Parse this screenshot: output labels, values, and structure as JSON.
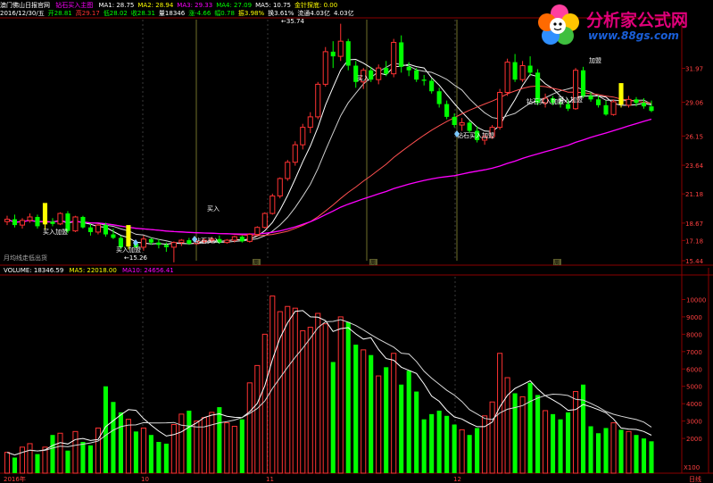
{
  "header": {
    "title": "澳门佛山日报官网",
    "indicator_name": "钻石买入主图",
    "row1_values": [
      {
        "text": "MA1: 28.75",
        "color": "#ffffff"
      },
      {
        "text": "MA2: 28.94",
        "color": "#ffff00"
      },
      {
        "text": "MA3: 29.33",
        "color": "#ff00ff"
      },
      {
        "text": "MA4: 27.09",
        "color": "#00ff00"
      },
      {
        "text": "MA5: 10.75",
        "color": "#ffffff"
      },
      {
        "text": "金针探底: 0.00",
        "color": "#ffff00"
      }
    ],
    "row2_values": [
      {
        "text": "2016/12/30/五",
        "color": "#ffffff"
      },
      {
        "text": "开28.81",
        "color": "#00ff00"
      },
      {
        "text": "高29.17",
        "color": "#ff3030"
      },
      {
        "text": "低28.02",
        "color": "#00ff00"
      },
      {
        "text": "收28.31",
        "color": "#00ff00"
      },
      {
        "text": "量18346",
        "color": "#ffffff"
      },
      {
        "text": "涨-4.66",
        "color": "#00ff00"
      },
      {
        "text": "幅0.78",
        "color": "#00ff00"
      },
      {
        "text": "振3.98%",
        "color": "#ffff00"
      },
      {
        "text": "换3.61%",
        "color": "#ffffff"
      },
      {
        "text": "流通4.03亿",
        "color": "#ffffff"
      },
      {
        "text": "4.03亿",
        "color": "#ffffff"
      }
    ]
  },
  "watermark": {
    "title": "分析家公式网",
    "url": "www.88gs.com"
  },
  "price_panel": {
    "y_axis": [
      "31.97",
      "29.06",
      "26.15",
      "23.64",
      "21.18",
      "18.67",
      "17.18",
      "15.44"
    ],
    "peak_label": "←35.74",
    "low_label": "←15.26",
    "annotations": [
      {
        "text": "买入加盟"
      },
      {
        "text": "买入加盟"
      },
      {
        "text": "钻石买入"
      },
      {
        "text": "钻石买入加盟"
      },
      {
        "text": "钻石买入加盟"
      },
      {
        "text": "买入加盟"
      },
      {
        "text": "买入"
      },
      {
        "text": "买入"
      },
      {
        "text": "加盟"
      }
    ],
    "bottom_left_label": "月均线走低出货",
    "markers": [
      "周",
      "周",
      "周"
    ]
  },
  "volume_panel": {
    "label": "VOLUME: 18346.59",
    "ma5": "MA5: 22018.00",
    "ma10": "MA10: 24656.41",
    "y_axis": [
      "10000",
      "9000",
      "8000",
      "7000",
      "6000",
      "5000",
      "4000",
      "3000",
      "2000"
    ],
    "unit": "X100"
  },
  "x_axis": {
    "labels": [
      "2016年",
      "10",
      "11",
      "12"
    ],
    "right_label": "日线"
  },
  "colors": {
    "up": "#ff3232",
    "down": "#00ff00",
    "background": "#000000",
    "ma_short": "#ffffff",
    "ma_mid": "#ff5050",
    "ma_long": "#ff00ff",
    "highlight": "#ffff00"
  },
  "chart_data": {
    "type": "candlestick",
    "y_range": [
      15.44,
      36.0
    ],
    "volume_range": [
      0,
      11000
    ],
    "candles": [
      {
        "o": 18.8,
        "h": 19.3,
        "l": 18.5,
        "c": 19.0,
        "v": 1200
      },
      {
        "o": 19.0,
        "h": 19.4,
        "l": 18.3,
        "c": 18.5,
        "v": 900
      },
      {
        "o": 18.5,
        "h": 19.1,
        "l": 18.2,
        "c": 18.9,
        "v": 1500
      },
      {
        "o": 18.9,
        "h": 19.5,
        "l": 18.7,
        "c": 19.2,
        "v": 1700
      },
      {
        "o": 19.2,
        "h": 19.4,
        "l": 18.2,
        "c": 18.4,
        "v": 1100
      },
      {
        "o": 18.4,
        "h": 19.0,
        "l": 18.1,
        "c": 18.8,
        "v": 1500
      },
      {
        "o": 18.8,
        "h": 19.1,
        "l": 18.4,
        "c": 18.6,
        "v": 2200
      },
      {
        "o": 18.6,
        "h": 19.6,
        "l": 18.5,
        "c": 19.5,
        "v": 2300
      },
      {
        "o": 19.5,
        "h": 19.7,
        "l": 17.8,
        "c": 18.0,
        "v": 1300
      },
      {
        "o": 18.0,
        "h": 19.3,
        "l": 17.9,
        "c": 19.2,
        "v": 2400
      },
      {
        "o": 19.2,
        "h": 19.3,
        "l": 18.2,
        "c": 18.3,
        "v": 1800
      },
      {
        "o": 18.3,
        "h": 18.6,
        "l": 17.6,
        "c": 17.9,
        "v": 1600
      },
      {
        "o": 17.9,
        "h": 18.6,
        "l": 17.7,
        "c": 18.5,
        "v": 2600
      },
      {
        "o": 18.5,
        "h": 18.7,
        "l": 17.5,
        "c": 17.7,
        "v": 5000
      },
      {
        "o": 17.7,
        "h": 18.2,
        "l": 17.3,
        "c": 17.4,
        "v": 4100
      },
      {
        "o": 17.4,
        "h": 17.6,
        "l": 16.4,
        "c": 16.6,
        "v": 3500
      },
      {
        "o": 16.6,
        "h": 17.2,
        "l": 16.4,
        "c": 16.9,
        "v": 3100
      },
      {
        "o": 16.9,
        "h": 17.0,
        "l": 16.5,
        "c": 16.6,
        "v": 2400
      },
      {
        "o": 16.6,
        "h": 17.6,
        "l": 16.3,
        "c": 17.3,
        "v": 2600
      },
      {
        "o": 17.3,
        "h": 17.4,
        "l": 16.8,
        "c": 17.0,
        "v": 2200
      },
      {
        "o": 17.0,
        "h": 17.3,
        "l": 16.5,
        "c": 16.8,
        "v": 1800
      },
      {
        "o": 16.8,
        "h": 17.0,
        "l": 16.2,
        "c": 16.6,
        "v": 1700
      },
      {
        "o": 16.6,
        "h": 17.1,
        "l": 15.3,
        "c": 17.0,
        "v": 2800
      },
      {
        "o": 17.0,
        "h": 17.3,
        "l": 16.7,
        "c": 17.2,
        "v": 3400
      },
      {
        "o": 17.2,
        "h": 17.4,
        "l": 16.8,
        "c": 16.9,
        "v": 3600
      },
      {
        "o": 16.9,
        "h": 17.3,
        "l": 16.8,
        "c": 17.1,
        "v": 3000
      },
      {
        "o": 17.1,
        "h": 17.4,
        "l": 16.9,
        "c": 17.2,
        "v": 3200
      },
      {
        "o": 17.2,
        "h": 17.5,
        "l": 17.0,
        "c": 17.3,
        "v": 3500
      },
      {
        "o": 17.3,
        "h": 17.6,
        "l": 16.9,
        "c": 17.0,
        "v": 3800
      },
      {
        "o": 17.0,
        "h": 17.3,
        "l": 16.9,
        "c": 17.2,
        "v": 2900
      },
      {
        "o": 17.2,
        "h": 17.6,
        "l": 17.0,
        "c": 17.5,
        "v": 2700
      },
      {
        "o": 17.5,
        "h": 17.6,
        "l": 17.0,
        "c": 17.1,
        "v": 3100
      },
      {
        "o": 17.1,
        "h": 17.8,
        "l": 17.0,
        "c": 17.7,
        "v": 5200
      },
      {
        "o": 17.7,
        "h": 18.4,
        "l": 17.6,
        "c": 18.3,
        "v": 6200
      },
      {
        "o": 18.3,
        "h": 19.6,
        "l": 18.2,
        "c": 19.5,
        "v": 8000
      },
      {
        "o": 19.5,
        "h": 21.2,
        "l": 19.4,
        "c": 21.0,
        "v": 10200
      },
      {
        "o": 21.0,
        "h": 22.6,
        "l": 20.8,
        "c": 22.5,
        "v": 9300
      },
      {
        "o": 22.5,
        "h": 24.1,
        "l": 22.3,
        "c": 23.9,
        "v": 9600
      },
      {
        "o": 23.9,
        "h": 25.7,
        "l": 23.6,
        "c": 25.4,
        "v": 9500
      },
      {
        "o": 25.4,
        "h": 27.2,
        "l": 25.0,
        "c": 26.9,
        "v": 8200
      },
      {
        "o": 26.9,
        "h": 28.2,
        "l": 26.4,
        "c": 27.8,
        "v": 8400
      },
      {
        "o": 27.8,
        "h": 30.8,
        "l": 27.6,
        "c": 30.6,
        "v": 9200
      },
      {
        "o": 30.6,
        "h": 33.8,
        "l": 30.4,
        "c": 33.4,
        "v": 8600
      },
      {
        "o": 33.4,
        "h": 34.3,
        "l": 32.0,
        "c": 33.0,
        "v": 6400
      },
      {
        "o": 33.0,
        "h": 35.8,
        "l": 32.6,
        "c": 34.3,
        "v": 9000
      },
      {
        "o": 34.3,
        "h": 34.5,
        "l": 31.8,
        "c": 32.2,
        "v": 8700
      },
      {
        "o": 32.2,
        "h": 32.6,
        "l": 30.3,
        "c": 30.8,
        "v": 7400
      },
      {
        "o": 30.8,
        "h": 32.0,
        "l": 30.2,
        "c": 31.8,
        "v": 7100
      },
      {
        "o": 31.8,
        "h": 32.1,
        "l": 30.8,
        "c": 31.0,
        "v": 6800
      },
      {
        "o": 31.0,
        "h": 32.3,
        "l": 30.6,
        "c": 32.0,
        "v": 5600
      },
      {
        "o": 32.0,
        "h": 32.6,
        "l": 31.3,
        "c": 31.5,
        "v": 6100
      },
      {
        "o": 31.5,
        "h": 34.5,
        "l": 31.2,
        "c": 34.2,
        "v": 6900
      },
      {
        "o": 34.2,
        "h": 34.8,
        "l": 31.6,
        "c": 32.1,
        "v": 5100
      },
      {
        "o": 32.1,
        "h": 32.5,
        "l": 31.3,
        "c": 31.8,
        "v": 5900
      },
      {
        "o": 31.8,
        "h": 32.0,
        "l": 30.8,
        "c": 31.0,
        "v": 4700
      },
      {
        "o": 31.0,
        "h": 31.4,
        "l": 30.5,
        "c": 30.9,
        "v": 3100
      },
      {
        "o": 30.9,
        "h": 31.1,
        "l": 29.8,
        "c": 30.0,
        "v": 3400
      },
      {
        "o": 30.0,
        "h": 30.3,
        "l": 28.6,
        "c": 28.9,
        "v": 3600
      },
      {
        "o": 28.9,
        "h": 29.2,
        "l": 27.6,
        "c": 27.8,
        "v": 3300
      },
      {
        "o": 27.8,
        "h": 28.1,
        "l": 26.9,
        "c": 27.1,
        "v": 2800
      },
      {
        "o": 27.1,
        "h": 27.7,
        "l": 26.6,
        "c": 27.3,
        "v": 2500
      },
      {
        "o": 27.3,
        "h": 27.5,
        "l": 26.4,
        "c": 26.6,
        "v": 2200
      },
      {
        "o": 26.6,
        "h": 27.0,
        "l": 25.6,
        "c": 25.8,
        "v": 2600
      },
      {
        "o": 25.8,
        "h": 26.4,
        "l": 25.4,
        "c": 26.1,
        "v": 3300
      },
      {
        "o": 26.1,
        "h": 27.1,
        "l": 25.9,
        "c": 26.9,
        "v": 4100
      },
      {
        "o": 26.9,
        "h": 30.2,
        "l": 26.7,
        "c": 29.9,
        "v": 6900
      },
      {
        "o": 29.9,
        "h": 32.8,
        "l": 29.6,
        "c": 32.5,
        "v": 5500
      },
      {
        "o": 32.5,
        "h": 33.2,
        "l": 30.8,
        "c": 31.0,
        "v": 4600
      },
      {
        "o": 31.0,
        "h": 32.6,
        "l": 30.8,
        "c": 32.2,
        "v": 4400
      },
      {
        "o": 32.2,
        "h": 33.0,
        "l": 31.3,
        "c": 31.6,
        "v": 5200
      },
      {
        "o": 31.6,
        "h": 31.9,
        "l": 28.8,
        "c": 29.0,
        "v": 4500
      },
      {
        "o": 29.0,
        "h": 29.8,
        "l": 28.6,
        "c": 29.4,
        "v": 3600
      },
      {
        "o": 29.4,
        "h": 29.6,
        "l": 28.8,
        "c": 29.0,
        "v": 3400
      },
      {
        "o": 29.0,
        "h": 29.4,
        "l": 28.6,
        "c": 28.9,
        "v": 3100
      },
      {
        "o": 28.9,
        "h": 29.3,
        "l": 28.3,
        "c": 28.5,
        "v": 3500
      },
      {
        "o": 28.5,
        "h": 32.0,
        "l": 28.4,
        "c": 31.8,
        "v": 4700
      },
      {
        "o": 31.8,
        "h": 32.1,
        "l": 29.4,
        "c": 29.6,
        "v": 5100
      },
      {
        "o": 29.6,
        "h": 29.9,
        "l": 29.1,
        "c": 29.3,
        "v": 2700
      },
      {
        "o": 29.3,
        "h": 29.6,
        "l": 28.6,
        "c": 28.8,
        "v": 2300
      },
      {
        "o": 28.8,
        "h": 29.2,
        "l": 27.9,
        "c": 28.0,
        "v": 2600
      },
      {
        "o": 28.0,
        "h": 29.3,
        "l": 27.9,
        "c": 29.1,
        "v": 2900
      },
      {
        "o": 29.1,
        "h": 29.4,
        "l": 28.6,
        "c": 28.8,
        "v": 2500
      },
      {
        "o": 28.8,
        "h": 29.6,
        "l": 28.6,
        "c": 29.3,
        "v": 2400
      },
      {
        "o": 29.3,
        "h": 29.5,
        "l": 28.7,
        "c": 29.0,
        "v": 2200
      },
      {
        "o": 29.0,
        "h": 29.4,
        "l": 28.5,
        "c": 28.7,
        "v": 2000
      },
      {
        "o": 28.7,
        "h": 29.2,
        "l": 28.2,
        "c": 28.31,
        "v": 1835
      }
    ],
    "highlight_indices": [
      5,
      16,
      81,
      89
    ]
  }
}
